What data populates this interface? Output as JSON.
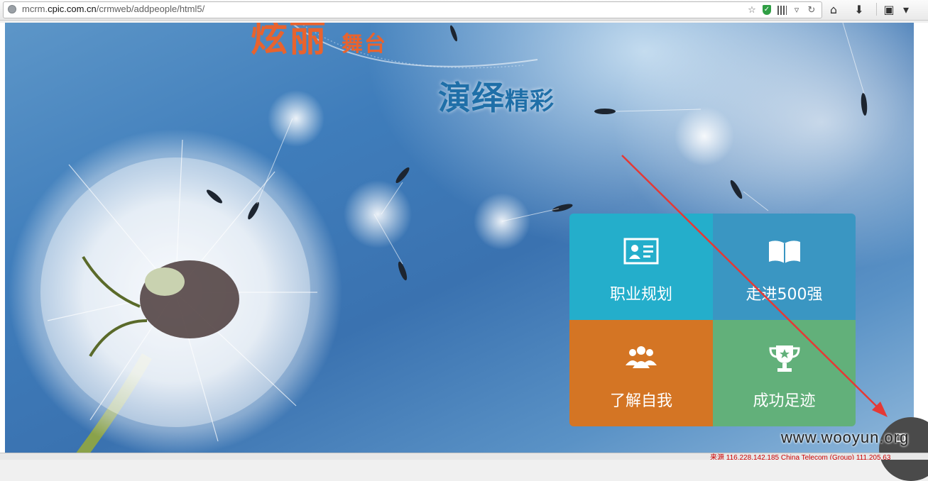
{
  "browser": {
    "url_prefix": "mcrm.",
    "url_domain": "cpic.com.cn",
    "url_path": "/crmweb/addpeople/html5/",
    "icons": [
      "globe-icon",
      "star-icon",
      "shield-icon",
      "qr-icon",
      "dropdown-icon",
      "reload-icon",
      "home-icon",
      "download-icon",
      "screenshot-icon",
      "menu-dropdown-icon"
    ]
  },
  "banner": {
    "title_main": "炫丽",
    "title_small": "舞台",
    "subtitle_big": "演绎",
    "subtitle_small": "精彩"
  },
  "menu": {
    "tiles": [
      {
        "label": "职业规划",
        "icon": "id-card-icon",
        "color": "#24aecb"
      },
      {
        "label": "走进500强",
        "icon": "open-book-icon",
        "color": "#3a96c2"
      },
      {
        "label": "了解自我",
        "icon": "people-group-icon",
        "color": "#d47524"
      },
      {
        "label": "成功足迹",
        "icon": "trophy-icon",
        "color": "#62b07a"
      }
    ]
  },
  "overlay": {
    "watermark": "www.wooyun.org",
    "arrow_color": "#e53935"
  },
  "status": {
    "text": "来源 116.228.142.185 China Telecom (Group) 111.205.63"
  }
}
